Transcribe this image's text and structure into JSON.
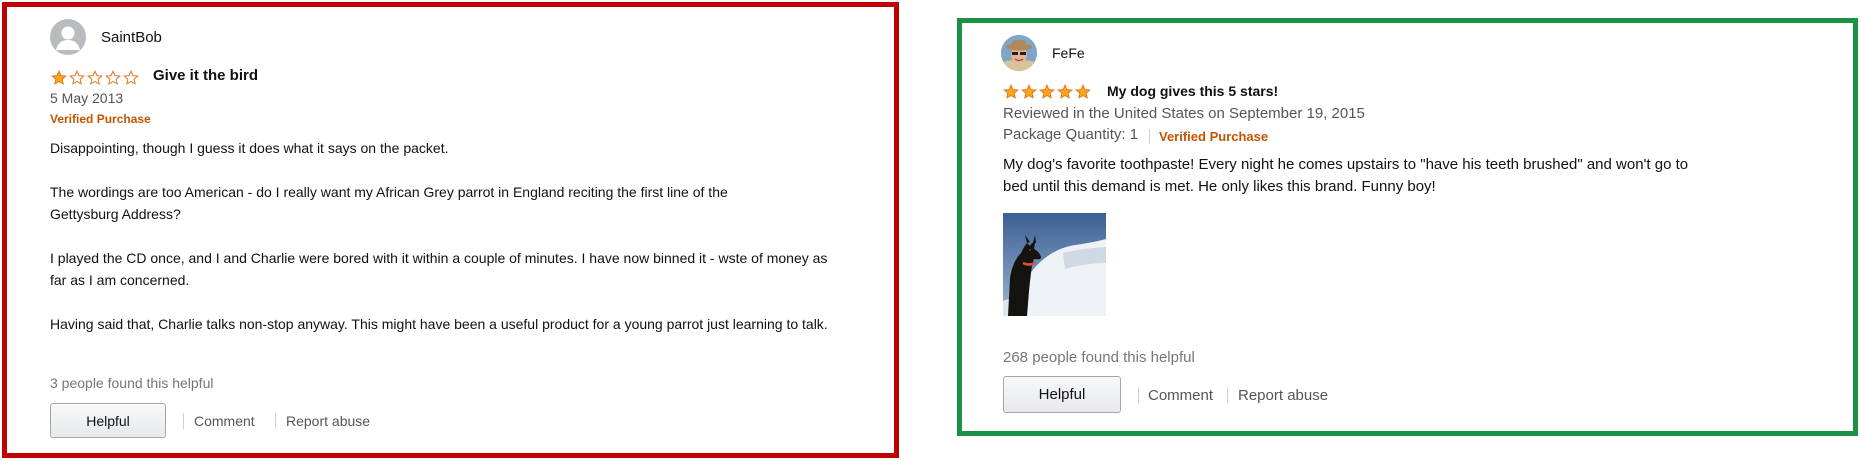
{
  "reviews": [
    {
      "author": "SaintBob",
      "rating": 1,
      "max_rating": 5,
      "title": "Give it the bird",
      "date": "5 May 2013",
      "verified": "Verified Purchase",
      "paragraphs": [
        "Disappointing, though I guess it does what it says on the packet.",
        "The wordings are too American - do I really want my African Grey parrot in England reciting the first line of the Gettysburg Address?",
        "I played the CD once, and I and Charlie were bored with it within a couple of minutes. I have now binned it - wste of money as far as I am concerned.",
        "Having said that, Charlie talks non-stop anyway. This might have been a useful product for a young parrot just learning to talk."
      ],
      "helpful_count": "3 people found this helpful",
      "helpful_label": "Helpful",
      "comment_label": "Comment",
      "report_label": "Report abuse",
      "border_color": "#c00000"
    },
    {
      "author": "FeFe",
      "rating": 5,
      "max_rating": 5,
      "title": "My dog gives this 5 stars!",
      "date": "Reviewed in the United States on September 19, 2015",
      "package_quantity": "Package Quantity: 1",
      "verified": "Verified Purchase",
      "paragraphs": [
        "My dog's favorite toothpaste! Every night he comes upstairs to \"have his teeth brushed\" and won't go to bed until this demand is met. He only likes this brand. Funny boy!"
      ],
      "helpful_count": "268 people found this helpful",
      "helpful_label": "Helpful",
      "comment_label": "Comment",
      "report_label": "Report abuse",
      "border_color": "#1a9146"
    }
  ],
  "icons": {
    "default_avatar": "default-avatar-icon",
    "profile_photo": "profile-photo",
    "star": "star-icon",
    "review_image": "dog-in-snow-photo"
  },
  "colors": {
    "star_fill": "#ffa41c",
    "star_outline": "#de7921",
    "verified": "#c45500"
  }
}
